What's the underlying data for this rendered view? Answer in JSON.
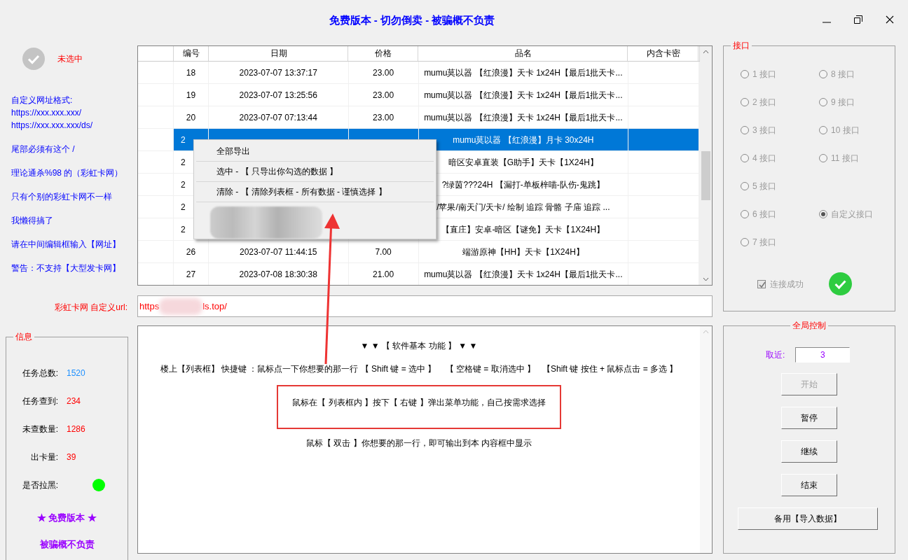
{
  "window": {
    "title": "免费版本 - 切勿倒卖 - 被骗概不负责"
  },
  "status": {
    "checked": false,
    "label": "未选中"
  },
  "notes": [
    "自定义网址格式:",
    "https://xxx.xxx.xxx/",
    "https://xxx.xxx.xxx/ds/",
    "尾部必须有这个 /",
    "理论通杀%98 的（彩虹卡网）",
    "只有个别的彩虹卡网不一样",
    "我懒得搞了",
    "请在中间编辑框输入【网址】",
    "警告：不支持【大型发卡网】"
  ],
  "table": {
    "columns": [
      "编号",
      "日期",
      "价格",
      "品名",
      "内含卡密"
    ],
    "rows": [
      {
        "id": "18",
        "date": "2023-07-07 13:37:17",
        "price": "23.00",
        "name": "mumu莫以器 【红浪漫】天卡 1x24H【最后1批天卡...",
        "selected": false
      },
      {
        "id": "19",
        "date": "2023-07-07 13:25:56",
        "price": "23.00",
        "name": "mumu莫以器 【红浪漫】天卡 1x24H【最后1批天卡...",
        "selected": false
      },
      {
        "id": "20",
        "date": "2023-07-07 07:13:44",
        "price": "23.00",
        "name": "mumu莫以器 【红浪漫】天卡 1x24H【最后1批天卡...",
        "selected": false
      },
      {
        "id": "2",
        "name": "mumu莫以器 【红浪漫】月卡 30x24H",
        "selected": true
      },
      {
        "id": "2",
        "name": "暗区安卓直装【G助手】天卡【1X24H】",
        "selected": false
      },
      {
        "id": "2",
        "name": "?绿茵???24H 【漏打-单板梓喵-队伤-鬼跳】",
        "selected": false
      },
      {
        "id": "2",
        "name": "/苹果/南天门/天卡/ 绘制 追踪 骨骼 子庙 追踪 ...",
        "selected": false
      },
      {
        "id": "2",
        "name": "【直庄】安卓-暗区【谜免】天卡【1X24H】",
        "selected": false
      },
      {
        "id": "26",
        "date": "2023-07-07 11:44:15",
        "price": "7.00",
        "name": "端游原神【HH】天卡【1X24H】",
        "selected": false
      },
      {
        "id": "27",
        "date": "2023-07-08 18:30:38",
        "price": "21.00",
        "name": "mumu莫以器 【红浪漫】天卡 1x24H【最后1批天卡...",
        "selected": false
      }
    ]
  },
  "context_menu": [
    {
      "kind": "text",
      "label": "全部导出"
    },
    {
      "kind": "text",
      "label": "选中 - 【 只导出你勾选的数据 】"
    },
    {
      "kind": "text",
      "label": "清除 - 【 清除列表框 - 所有数据 - 谨慎选择 】"
    },
    {
      "kind": "redacted"
    }
  ],
  "url": {
    "label": "彩虹卡网 自定义url:",
    "value_start": "https",
    "value_end": "ls.top/"
  },
  "info": {
    "title": "信息",
    "rows": [
      {
        "kind": "value",
        "label": "任务总数:",
        "value": "1520",
        "color": "#1e90ff"
      },
      {
        "kind": "value",
        "label": "任务查到:",
        "value": "234",
        "color": "#ff0000"
      },
      {
        "kind": "value",
        "label": "未查数量:",
        "value": "1286",
        "color": "#ff0000"
      },
      {
        "kind": "value",
        "label": "出卡量:",
        "value": "39",
        "color": "#ff0000"
      },
      {
        "kind": "dot",
        "label": "是否拉黑:",
        "color": "#00ff00"
      }
    ],
    "footer": [
      "★ 免费版本 ★",
      "被骗概不负责"
    ]
  },
  "help": [
    {
      "text": "▼ ▼ 【 软件基本 功能 】 ▼ ▼",
      "boxed": false
    },
    {
      "text": "楼上【列表框】 快捷键 ：鼠标点一下你想要的那一行 【 Shift 键 = 选中 】    【 空格键 = 取消选中 】   【Shift 键 按住 + 鼠标点击 = 多选 】",
      "boxed": false
    },
    {
      "text": "鼠标在【 列表框内 】按下【 右键 】弹出菜单功能，自己按需求选择",
      "boxed": true
    },
    {
      "text": "鼠标【 双击 】你想要的那一行，即可输出到本 内容框中显示",
      "boxed": false
    }
  ],
  "interfaces": {
    "title": "接口",
    "disabled": true,
    "left": [
      {
        "label": "1  接口",
        "selected": false
      },
      {
        "label": "2  接口",
        "selected": false
      },
      {
        "label": "3  接口",
        "selected": false
      },
      {
        "label": "4  接口",
        "selected": false
      },
      {
        "label": "5  接口",
        "selected": false
      },
      {
        "label": "6  接口",
        "selected": false
      },
      {
        "label": "7  接口",
        "selected": false
      }
    ],
    "right": [
      {
        "label": "8  接口",
        "selected": false
      },
      {
        "label": "9  接口",
        "selected": false
      },
      {
        "label": "10  接口",
        "selected": false
      },
      {
        "label": "11  接口",
        "selected": false
      }
    ],
    "custom": {
      "label": "自定义接口",
      "selected": true
    },
    "connected": {
      "label": "连接成功",
      "checked": true,
      "ok": true
    }
  },
  "control": {
    "title": "全局控制",
    "field_label": "取近:",
    "field_value": "3",
    "buttons": [
      {
        "label": "开始",
        "disabled": true
      },
      {
        "label": "暂停",
        "disabled": false
      },
      {
        "label": "继续",
        "disabled": false
      },
      {
        "label": "结束",
        "disabled": false
      }
    ],
    "extra_button": {
      "label": "备用【导入数据】",
      "disabled": false
    }
  }
}
